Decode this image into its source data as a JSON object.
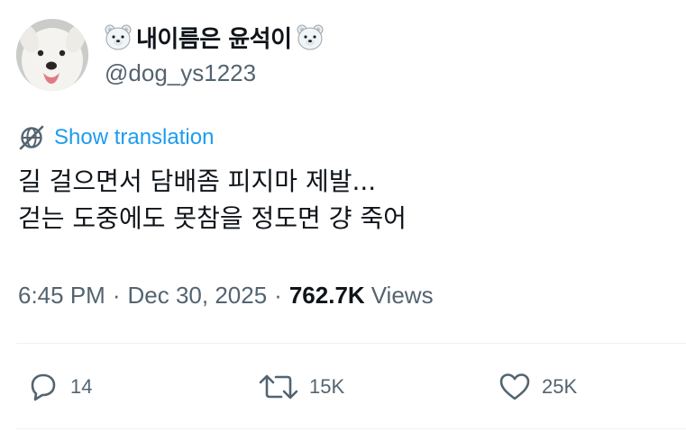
{
  "author": {
    "display_name": "내이름은 윤석이",
    "handle": "@dog_ys1223",
    "avatar_icon": "white-dog-avatar",
    "name_emoji": "polar-bear-icon"
  },
  "translate": {
    "icon": "globe-translate-icon",
    "label": "Show translation"
  },
  "tweet": {
    "text": "길 걸으면서 담배좀 피지마 제발...\n걷는 도중에도 못참을 정도면 걍 죽어"
  },
  "meta": {
    "time": "6:45 PM",
    "separator": "·",
    "date": "Dec 30, 2025",
    "views_count": "762.7K",
    "views_label": "Views"
  },
  "actions": {
    "replies": "14",
    "reposts": "15K",
    "likes": "25K"
  },
  "colors": {
    "text": "#0f1419",
    "secondary": "#536471",
    "link": "#1d9bf0",
    "divider": "#eff3f4"
  }
}
